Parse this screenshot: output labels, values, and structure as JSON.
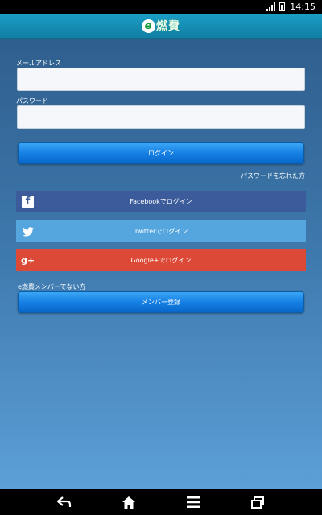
{
  "status_bar": {
    "time": "14:15",
    "network": "LTE"
  },
  "app_bar": {
    "logo_letter": "e",
    "logo_text": "燃費"
  },
  "form": {
    "email_label": "メールアドレス",
    "email_value": "",
    "password_label": "パスワード",
    "password_value": "",
    "login_button": "ログイン",
    "forgot_link": "パスワードを忘れた方"
  },
  "social": {
    "facebook_label": "Facebookでログイン",
    "twitter_label": "Twitterでログイン",
    "google_label": "Google+でログイン",
    "google_icon_text": "g+"
  },
  "register": {
    "prompt": "e燃費メンバーでない方",
    "button": "メンバー登録"
  },
  "colors": {
    "app_bar": "#1b9fc6",
    "facebook": "#3b5b9b",
    "twitter": "#55a6de",
    "google": "#dc4a37",
    "primary_button": "#1580e4"
  },
  "navigation": {
    "back_icon": "back-icon",
    "home_icon": "home-icon",
    "menu_icon": "menu-icon",
    "recents_icon": "recent-apps-icon"
  }
}
